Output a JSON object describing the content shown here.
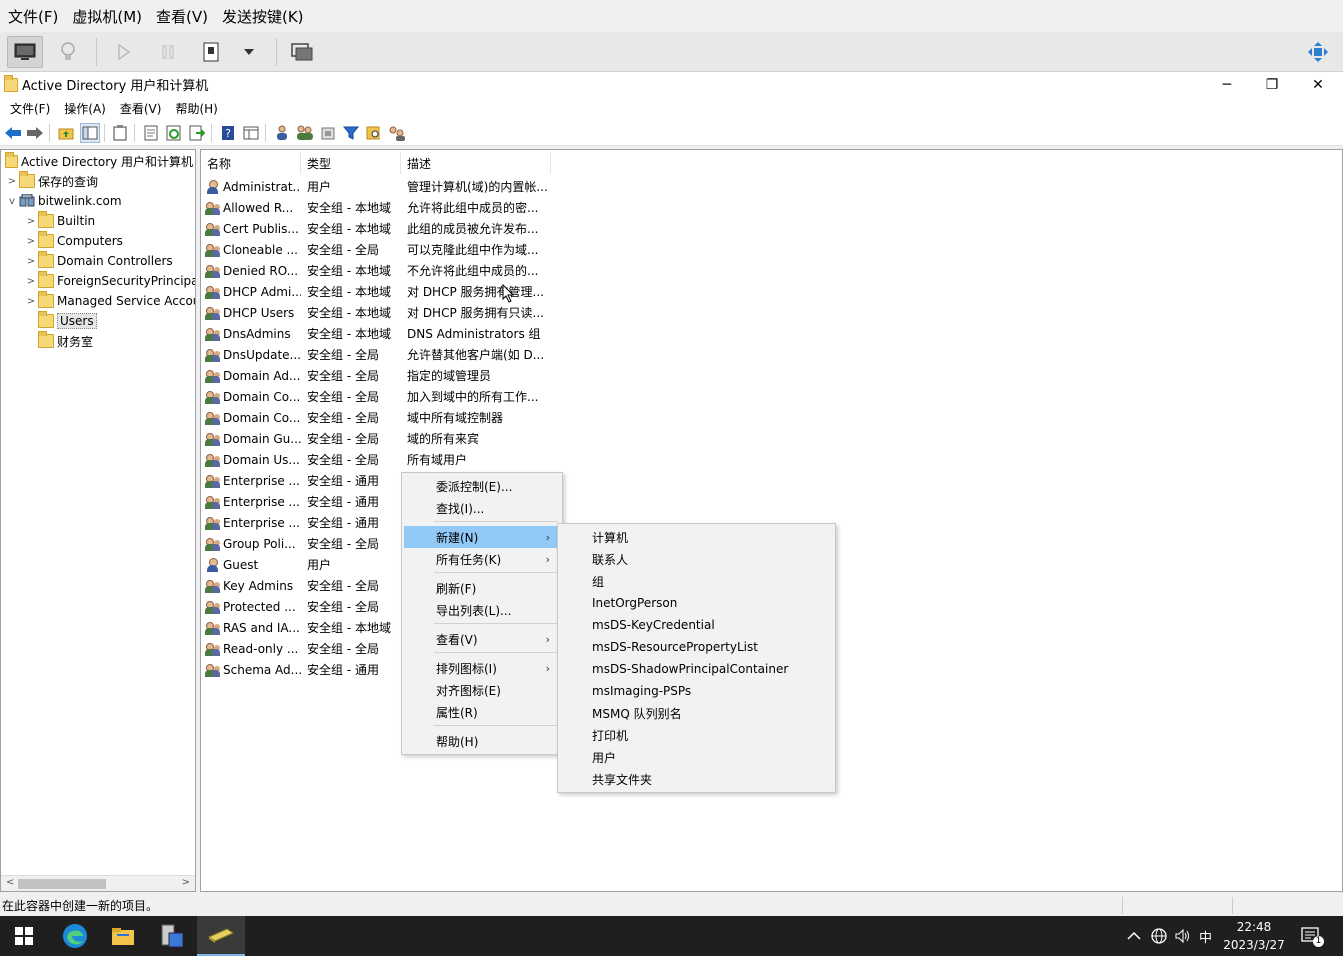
{
  "host_menu": [
    "文件(F)",
    "虚拟机(M)",
    "查看(V)",
    "发送按键(K)"
  ],
  "window": {
    "title": "Active Directory 用户和计算机",
    "minimize": "─",
    "restore": "❐",
    "close": "✕"
  },
  "app_menu": [
    "文件(F)",
    "操作(A)",
    "查看(V)",
    "帮助(H)"
  ],
  "tree": {
    "root": "Active Directory 用户和计算机",
    "saved_queries": "保存的查询",
    "domain": "bitwelink.com",
    "children": [
      "Builtin",
      "Computers",
      "Domain Controllers",
      "ForeignSecurityPrincipals",
      "Managed Service Accounts",
      "Users",
      "财务室"
    ]
  },
  "list": {
    "headers": [
      "名称",
      "类型",
      "描述"
    ],
    "rows": [
      {
        "name": "Administrat...",
        "type": "用户",
        "desc": "管理计算机(域)的内置帐...",
        "icon": "user"
      },
      {
        "name": "Allowed R...",
        "type": "安全组 - 本地域",
        "desc": "允许将此组中成员的密...",
        "icon": "group"
      },
      {
        "name": "Cert Publis...",
        "type": "安全组 - 本地域",
        "desc": "此组的成员被允许发布...",
        "icon": "group"
      },
      {
        "name": "Cloneable ...",
        "type": "安全组 - 全局",
        "desc": "可以克隆此组中作为域...",
        "icon": "group"
      },
      {
        "name": "Denied RO...",
        "type": "安全组 - 本地域",
        "desc": "不允许将此组中成员的...",
        "icon": "group"
      },
      {
        "name": "DHCP Admi...",
        "type": "安全组 - 本地域",
        "desc": "对 DHCP 服务拥有管理...",
        "icon": "group"
      },
      {
        "name": "DHCP Users",
        "type": "安全组 - 本地域",
        "desc": "对 DHCP 服务拥有只读...",
        "icon": "group"
      },
      {
        "name": "DnsAdmins",
        "type": "安全组 - 本地域",
        "desc": "DNS Administrators 组",
        "icon": "group"
      },
      {
        "name": "DnsUpdate...",
        "type": "安全组 - 全局",
        "desc": "允许替其他客户端(如 D...",
        "icon": "group"
      },
      {
        "name": "Domain Ad...",
        "type": "安全组 - 全局",
        "desc": "指定的域管理员",
        "icon": "group"
      },
      {
        "name": "Domain Co...",
        "type": "安全组 - 全局",
        "desc": "加入到域中的所有工作...",
        "icon": "group"
      },
      {
        "name": "Domain Co...",
        "type": "安全组 - 全局",
        "desc": "域中所有域控制器",
        "icon": "group"
      },
      {
        "name": "Domain Gu...",
        "type": "安全组 - 全局",
        "desc": "域的所有来宾",
        "icon": "group"
      },
      {
        "name": "Domain Us...",
        "type": "安全组 - 全局",
        "desc": "所有域用户",
        "icon": "group"
      },
      {
        "name": "Enterprise ...",
        "type": "安全组 - 通用",
        "desc": "",
        "icon": "group"
      },
      {
        "name": "Enterprise ...",
        "type": "安全组 - 通用",
        "desc": "",
        "icon": "group"
      },
      {
        "name": "Enterprise ...",
        "type": "安全组 - 通用",
        "desc": "",
        "icon": "group"
      },
      {
        "name": "Group Poli...",
        "type": "安全组 - 全局",
        "desc": "",
        "icon": "group"
      },
      {
        "name": "Guest",
        "type": "用户",
        "desc": "",
        "icon": "user"
      },
      {
        "name": "Key Admins",
        "type": "安全组 - 全局",
        "desc": "",
        "icon": "group"
      },
      {
        "name": "Protected ...",
        "type": "安全组 - 全局",
        "desc": "",
        "icon": "group"
      },
      {
        "name": "RAS and IA...",
        "type": "安全组 - 本地域",
        "desc": "",
        "icon": "group"
      },
      {
        "name": "Read-only ...",
        "type": "安全组 - 全局",
        "desc": "",
        "icon": "group"
      },
      {
        "name": "Schema Ad...",
        "type": "安全组 - 通用",
        "desc": "",
        "icon": "group"
      }
    ]
  },
  "context_menu": {
    "delegate": "委派控制(E)...",
    "find": "查找(I)...",
    "new": "新建(N)",
    "all_tasks": "所有任务(K)",
    "refresh": "刷新(F)",
    "export": "导出列表(L)...",
    "view": "查看(V)",
    "arrange": "排列图标(I)",
    "align": "对齐图标(E)",
    "properties": "属性(R)",
    "help": "帮助(H)",
    "submenu_arrow": "›"
  },
  "new_submenu": [
    "计算机",
    "联系人",
    "组",
    "InetOrgPerson",
    "msDS-KeyCredential",
    "msDS-ResourcePropertyList",
    "msDS-ShadowPrincipalContainer",
    "msImaging-PSPs",
    "MSMQ 队列别名",
    "打印机",
    "用户",
    "共享文件夹"
  ],
  "status_text": "在此容器中创建一新的项目。",
  "taskbar": {
    "time": "22:48",
    "date": "2023/3/27",
    "ime": "中",
    "notif_count": "1"
  },
  "colors": {
    "menu_highlight": "#91c9f7",
    "taskbar": "#1f1f1f"
  }
}
